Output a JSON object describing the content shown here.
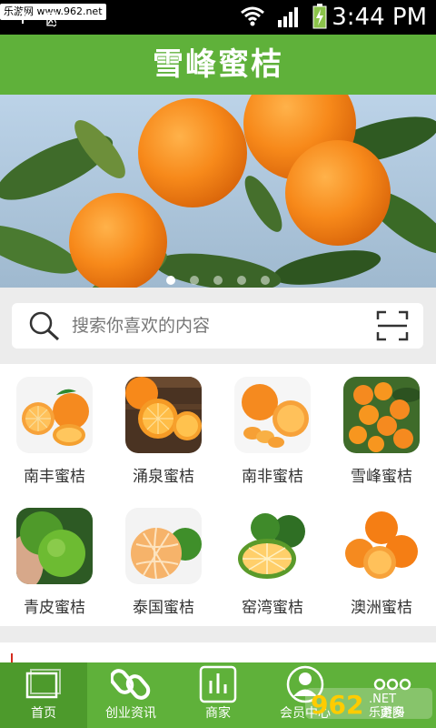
{
  "status_bar": {
    "watermark": "乐游网 www.962.net",
    "clock": "3:44 PM",
    "left_glyph": "USB 殴"
  },
  "header": {
    "title": "雪峰蜜桔"
  },
  "banner": {
    "slide_count": 5,
    "active_index": 0
  },
  "search": {
    "placeholder": "搜索你喜欢的内容"
  },
  "categories": [
    {
      "label": "南丰蜜桔"
    },
    {
      "label": "涌泉蜜桔"
    },
    {
      "label": "南非蜜桔"
    },
    {
      "label": "雪峰蜜桔"
    },
    {
      "label": "青皮蜜桔"
    },
    {
      "label": "泰国蜜桔"
    },
    {
      "label": "窑湾蜜桔"
    },
    {
      "label": "澳洲蜜桔"
    }
  ],
  "tabs": [
    {
      "label": "首页",
      "icon": "home-icon",
      "active": true
    },
    {
      "label": "创业资讯",
      "icon": "link-icon"
    },
    {
      "label": "商家",
      "icon": "chart-icon"
    },
    {
      "label": "会员中心",
      "icon": "user-icon"
    },
    {
      "label": "更多",
      "icon": "more-icon"
    }
  ],
  "watermark_logo": "962 乐游网 .NET",
  "colors": {
    "primary": "#5fb13a",
    "active_tab": "#4d9a2c",
    "background": "#ececec"
  }
}
